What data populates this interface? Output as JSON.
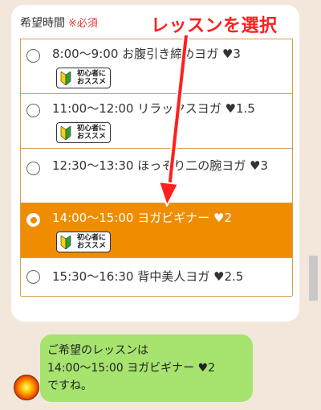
{
  "form": {
    "field_label": "希望時間",
    "required_mark": "※必須"
  },
  "annotation": {
    "callout_text": "レッスンを選択",
    "color": "#ff1f1f"
  },
  "options": [
    {
      "text": "8:00～9:00 お腹引き締めヨガ ♥3",
      "badge": true,
      "selected": false
    },
    {
      "text": "11:00～12:00 リラックスヨガ ♥1.5",
      "badge": true,
      "selected": false
    },
    {
      "text": "12:30～13:30 ほっそり二の腕ヨガ ♥3",
      "badge": false,
      "selected": false
    },
    {
      "text": "14:00～15:00 ヨガビギナー ♥2",
      "badge": true,
      "selected": true
    },
    {
      "text": "15:30～16:30 背中美人ヨガ ♥2.5",
      "badge": false,
      "selected": false
    }
  ],
  "badge": {
    "line1": "初心者に",
    "line2": "おススメ",
    "icon": "beginner-leaf-icon"
  },
  "chat": {
    "bubble_text": "ご希望のレッスンは\n14:00～15:00 ヨガビギナー ♥2\nですね。",
    "avatar_icon": "sun-avatar"
  },
  "colors": {
    "selected_bg": "#ef8c00",
    "bubble_bg": "#a6e36f",
    "page_bg": "#f3e7dc",
    "border": "#d79c50"
  }
}
